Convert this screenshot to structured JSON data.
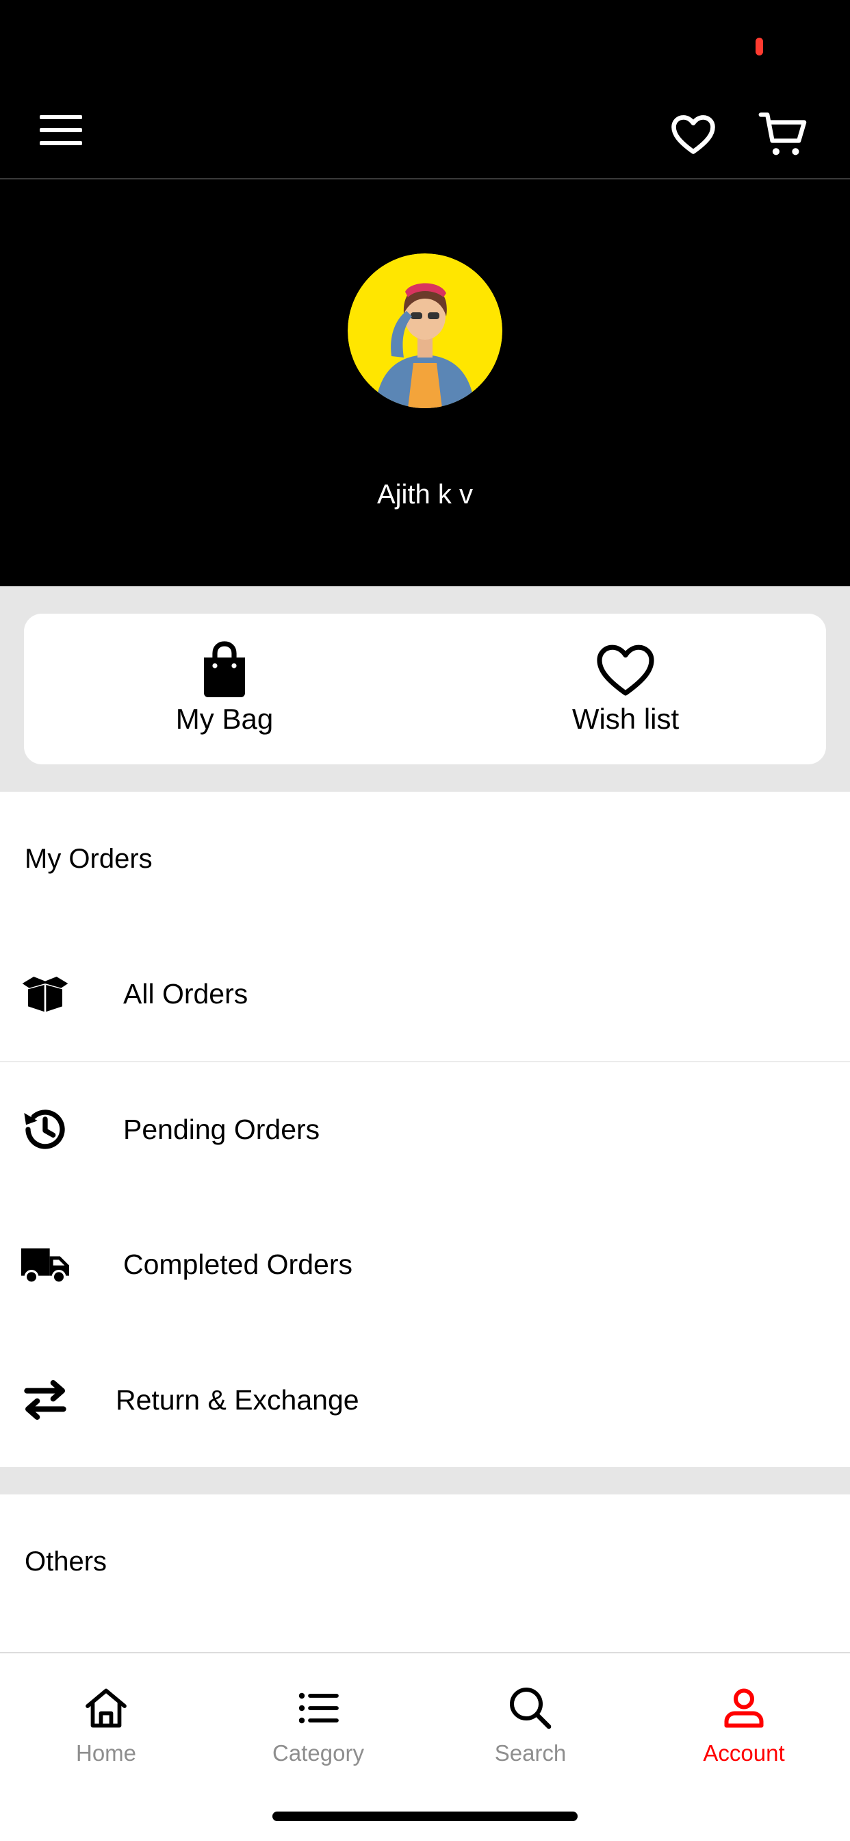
{
  "colors": {
    "header_bg": "#000000",
    "accent": "#ff0000",
    "inactive_tab": "#8e8e8e",
    "section_bg": "#e6e6e6",
    "avatar_bg": "#ffe600"
  },
  "header": {
    "icons": [
      "menu-icon",
      "heart-icon",
      "cart-icon"
    ]
  },
  "profile": {
    "name": "Ajith k v"
  },
  "quick_actions": [
    {
      "label": "My Bag",
      "icon": "shopping-bag-icon"
    },
    {
      "label": "Wish list",
      "icon": "heart-outline-icon"
    }
  ],
  "my_orders": {
    "title": "My Orders",
    "items": [
      {
        "label": "All Orders",
        "icon": "open-box-icon"
      },
      {
        "label": "Pending Orders",
        "icon": "history-icon"
      },
      {
        "label": "Completed Orders",
        "icon": "truck-icon"
      },
      {
        "label": "Return & Exchange",
        "icon": "swap-arrows-icon"
      }
    ]
  },
  "others": {
    "title": "Others"
  },
  "tabbar": {
    "active": "Account",
    "tabs": [
      {
        "label": "Home",
        "icon": "home-icon"
      },
      {
        "label": "Category",
        "icon": "list-icon"
      },
      {
        "label": "Search",
        "icon": "search-icon"
      },
      {
        "label": "Account",
        "icon": "user-icon"
      }
    ]
  }
}
